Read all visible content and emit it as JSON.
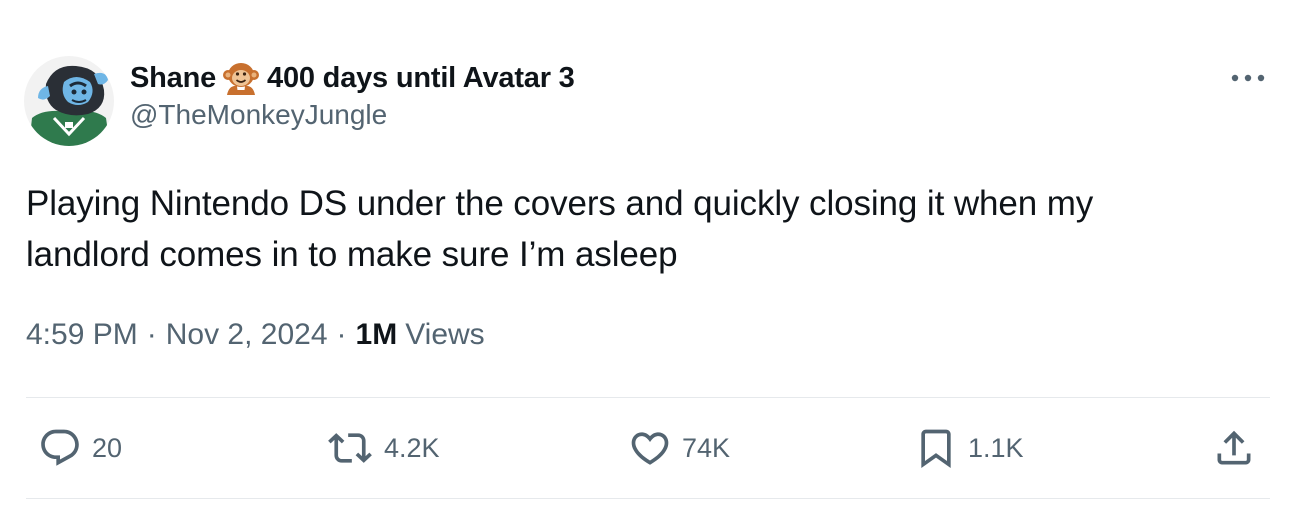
{
  "tweet": {
    "author": {
      "display_name": "Shane",
      "name_suffix": "400 days until Avatar 3",
      "handle": "@TheMonkeyJungle",
      "avatar_icon": "gorilla-avatar",
      "name_emoji_icon": "monkey-emoji-icon"
    },
    "text_line1": "Playing Nintendo DS under the covers and quickly closing it when my",
    "text_line2": "landlord comes in to make sure I’m asleep",
    "time": "4:59 PM",
    "date": "Nov 2, 2024",
    "separator": "·",
    "views_count": "1M",
    "views_label": "Views",
    "actions": {
      "replies": "20",
      "reposts": "4.2K",
      "likes": "74K",
      "bookmarks": "1.1K"
    }
  },
  "colors": {
    "text_primary": "#0f1419",
    "text_secondary": "#536471",
    "divider": "#e6e9ec",
    "background": "#ffffff"
  }
}
